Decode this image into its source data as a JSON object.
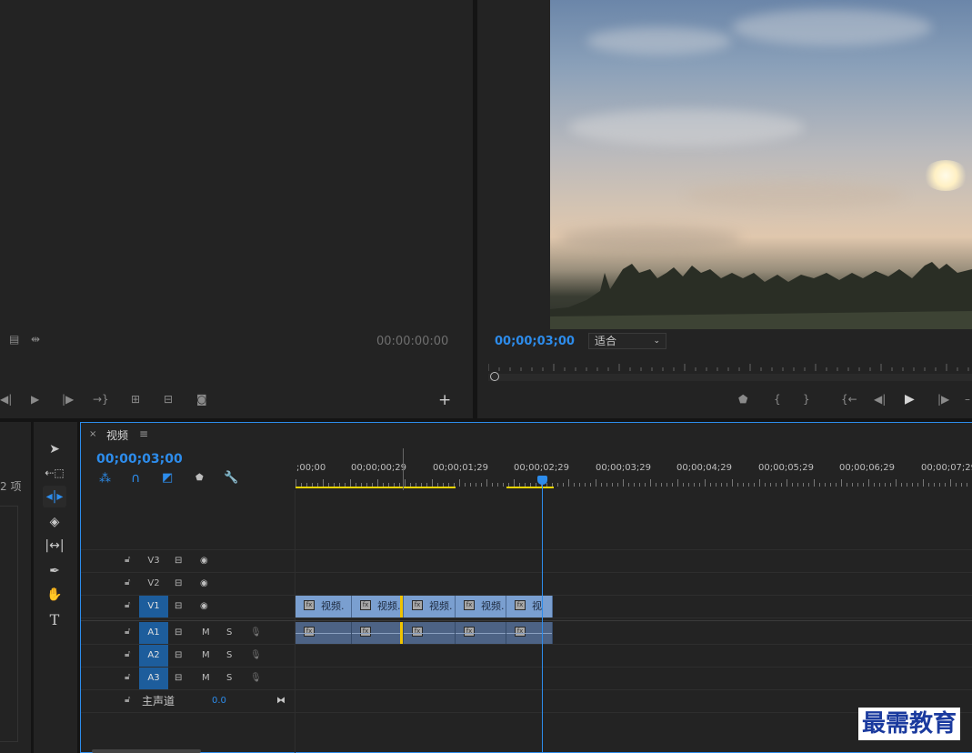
{
  "source": {
    "timecode": "00:00:00:00"
  },
  "program": {
    "timecode": "00;00;03;00",
    "fit_label": "适合",
    "fit_options": [
      "适合"
    ]
  },
  "left_strip": {
    "count_label": "2 项"
  },
  "timeline": {
    "tab_close": "×",
    "tab_title": "视频",
    "tab_menu": "≡",
    "timecode": "00;00;03;00",
    "ruler": [
      ";00;00",
      "00;00;00;29",
      "00;00;01;29",
      "00;00;02;29",
      "00;00;03;29",
      "00;00;04;29",
      "00;00;05;29",
      "00;00;06;29",
      "00;00;07;29"
    ],
    "video_tracks": [
      {
        "label": "V3",
        "active": false
      },
      {
        "label": "V2",
        "active": false
      },
      {
        "label": "V1",
        "active": true
      }
    ],
    "audio_tracks": [
      {
        "label": "A1",
        "m": "M",
        "s": "S"
      },
      {
        "label": "A2",
        "m": "M",
        "s": "S"
      },
      {
        "label": "A3",
        "m": "M",
        "s": "S"
      }
    ],
    "master": {
      "label": "主声道",
      "value": "0.0"
    },
    "clips": [
      {
        "name": "视频."
      },
      {
        "name": "视频."
      },
      {
        "name": "视频."
      },
      {
        "name": "视频."
      },
      {
        "name": "视"
      }
    ],
    "fx_label": "fx"
  },
  "watermark": "最需教育",
  "colors": {
    "accent": "#2d8ceb",
    "clip_video": "#7a9fd0",
    "clip_audio": "#4d6385",
    "in_out": "#e8d400"
  }
}
